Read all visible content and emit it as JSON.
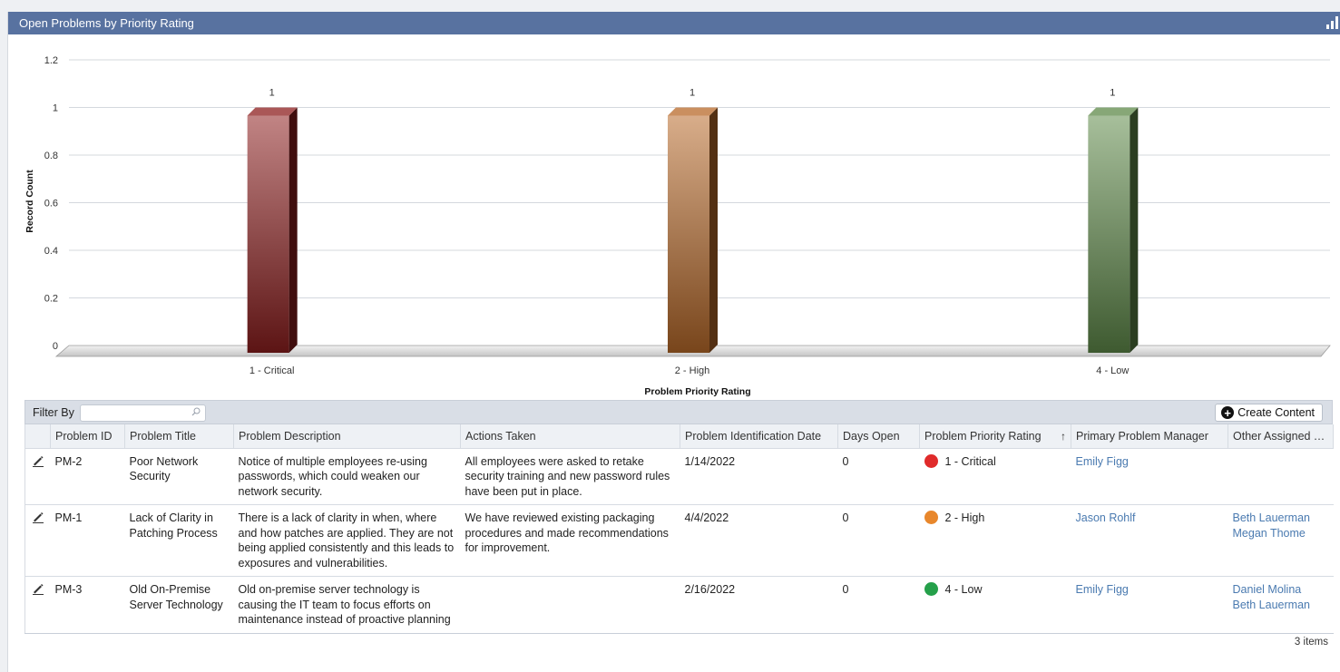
{
  "panel": {
    "title": "Open Problems by Priority Rating",
    "chart_icon": "bar-chart-icon"
  },
  "chart_data": {
    "type": "bar",
    "categories": [
      "1 - Critical",
      "2 - High",
      "4 - Low"
    ],
    "values": [
      1,
      1,
      1
    ],
    "data_labels": [
      "1",
      "1",
      "1"
    ],
    "colors": [
      "#8e1f1f",
      "#b86a2a",
      "#5f8a4a"
    ],
    "title": "",
    "xlabel": "Problem Priority Rating",
    "ylabel": "Record Count",
    "ylim": [
      0,
      1.2
    ],
    "yticks": [
      "0",
      "0.2",
      "0.4",
      "0.6",
      "0.8",
      "1",
      "1.2"
    ],
    "grid": true,
    "style": "3d-column"
  },
  "grid": {
    "filter_label": "Filter By",
    "filter_value": "",
    "filter_placeholder": "",
    "create_label": "Create Content",
    "columns": [
      "Problem ID",
      "Problem Title",
      "Problem Description",
      "Actions Taken",
      "Problem Identification Date",
      "Days Open",
      "Problem Priority Rating",
      "Primary Problem Manager",
      "Other Assigned T..."
    ],
    "sort_indicator": "↑",
    "rows": [
      {
        "id": "PM-2",
        "title": "Poor Network Security",
        "description": "Notice of multiple employees re-using passwords, which could weaken our network security.",
        "actions": "All employees were asked to retake security training and new password rules have been put in place.",
        "date": "1/14/2022",
        "days_open": "0",
        "priority": "1 - Critical",
        "priority_color": "#e02b2b",
        "manager": "Emily Figg",
        "others": []
      },
      {
        "id": "PM-1",
        "title": "Lack of Clarity in Patching Process",
        "description": "There is a lack of clarity in when, where and how patches are applied. They are not being applied consistently and this leads to exposures and vulnerabilities.",
        "actions": "We have reviewed existing packaging procedures and made recommendations for improvement.",
        "date": "4/4/2022",
        "days_open": "0",
        "priority": "2 - High",
        "priority_color": "#e8872c",
        "manager": "Jason Rohlf",
        "others": [
          "Beth Lauerman",
          "Megan Thome"
        ]
      },
      {
        "id": "PM-3",
        "title": "Old On-Premise Server Technology",
        "description": "Old on-premise server technology is causing the IT team to focus efforts on maintenance instead of proactive planning",
        "actions": "",
        "date": "2/16/2022",
        "days_open": "0",
        "priority": "4 - Low",
        "priority_color": "#25a04a",
        "manager": "Emily Figg",
        "others": [
          "Daniel Molina",
          "Beth Lauerman"
        ]
      }
    ],
    "items_count": "3 items"
  }
}
